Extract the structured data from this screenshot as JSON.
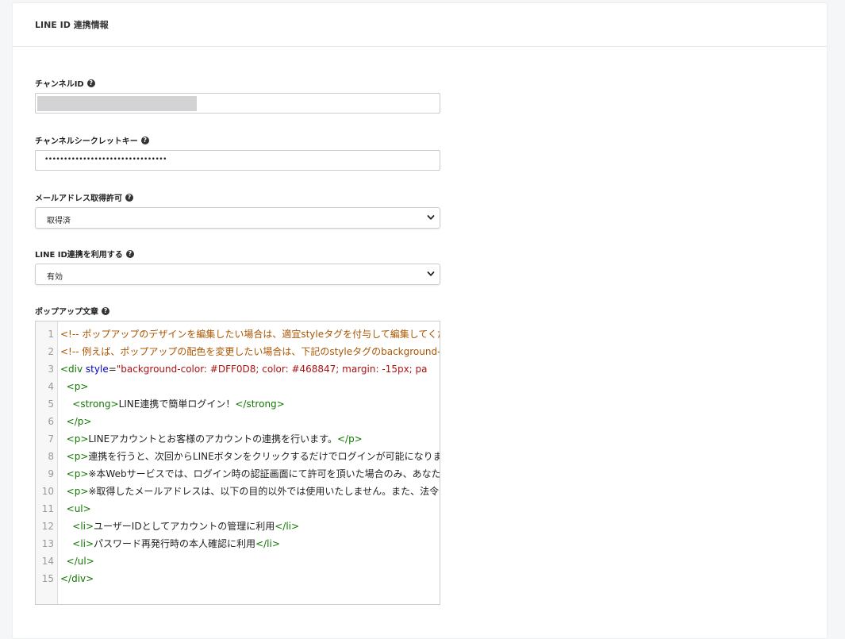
{
  "header": {
    "title": "LINE ID 連携情報"
  },
  "fields": {
    "channel_id": {
      "label": "チャンネルID"
    },
    "channel_secret": {
      "label": "チャンネルシークレットキー",
      "masked_value": "••••••••••••••••••••••••••••••••"
    },
    "email_permission": {
      "label": "メールアドレス取得許可",
      "selected": "取得済"
    },
    "line_id_enable": {
      "label": "LINE ID連携を利用する",
      "selected": "有効"
    },
    "popup_text": {
      "label": "ポップアップ文章"
    }
  },
  "code_lines": [
    {
      "n": "1",
      "parts": [
        {
          "t": "comment",
          "s": "<!-- ポップアップのデザインを編集したい場合は、適宜styleタグを付与して編集してくだ"
        }
      ]
    },
    {
      "n": "2",
      "parts": [
        {
          "t": "comment",
          "s": "<!-- 例えば、ポップアップの配色を変更したい場合は、下記のstyleタグのbackground-"
        }
      ]
    },
    {
      "n": "3",
      "parts": [
        {
          "t": "tag",
          "s": "<div "
        },
        {
          "t": "attr",
          "s": "style"
        },
        {
          "t": "plain",
          "s": "="
        },
        {
          "t": "str",
          "s": "\"background-color: #DFF0D8; color: #468847; margin: -15px; pa"
        }
      ]
    },
    {
      "n": "4",
      "parts": [
        {
          "t": "plain",
          "s": "  "
        },
        {
          "t": "tag",
          "s": "<p>"
        }
      ]
    },
    {
      "n": "5",
      "parts": [
        {
          "t": "plain",
          "s": "    "
        },
        {
          "t": "tag",
          "s": "<strong>"
        },
        {
          "t": "plain",
          "s": "LINE連携で簡単ログイン！"
        },
        {
          "t": "tag",
          "s": "</strong>"
        }
      ]
    },
    {
      "n": "6",
      "parts": [
        {
          "t": "plain",
          "s": "  "
        },
        {
          "t": "tag",
          "s": "</p>"
        }
      ]
    },
    {
      "n": "7",
      "parts": [
        {
          "t": "plain",
          "s": "  "
        },
        {
          "t": "tag",
          "s": "<p>"
        },
        {
          "t": "plain",
          "s": "LINEアカウントとお客様のアカウントの連携を行います。"
        },
        {
          "t": "tag",
          "s": "</p>"
        }
      ]
    },
    {
      "n": "8",
      "parts": [
        {
          "t": "plain",
          "s": "  "
        },
        {
          "t": "tag",
          "s": "<p>"
        },
        {
          "t": "plain",
          "s": "連携を行うと、次回からLINEボタンをクリックするだけでログインが可能になります。"
        }
      ]
    },
    {
      "n": "9",
      "parts": [
        {
          "t": "plain",
          "s": "  "
        },
        {
          "t": "tag",
          "s": "<p>"
        },
        {
          "t": "plain",
          "s": "※本Webサービスでは、ログイン時の認証画面にて許可を頂いた場合のみ、あなた"
        }
      ]
    },
    {
      "n": "10",
      "parts": [
        {
          "t": "plain",
          "s": "  "
        },
        {
          "t": "tag",
          "s": "<p>"
        },
        {
          "t": "plain",
          "s": "※取得したメールアドレスは、以下の目的以外では使用いたしません。また、法令に"
        }
      ]
    },
    {
      "n": "11",
      "parts": [
        {
          "t": "plain",
          "s": "  "
        },
        {
          "t": "tag",
          "s": "<ul>"
        }
      ]
    },
    {
      "n": "12",
      "parts": [
        {
          "t": "plain",
          "s": "    "
        },
        {
          "t": "tag",
          "s": "<li>"
        },
        {
          "t": "plain",
          "s": "ユーザーIDとしてアカウントの管理に利用"
        },
        {
          "t": "tag",
          "s": "</li>"
        }
      ]
    },
    {
      "n": "13",
      "parts": [
        {
          "t": "plain",
          "s": "    "
        },
        {
          "t": "tag",
          "s": "<li>"
        },
        {
          "t": "plain",
          "s": "パスワード再発行時の本人確認に利用"
        },
        {
          "t": "tag",
          "s": "</li>"
        }
      ]
    },
    {
      "n": "14",
      "parts": [
        {
          "t": "plain",
          "s": "  "
        },
        {
          "t": "tag",
          "s": "</ul>"
        }
      ]
    },
    {
      "n": "15",
      "parts": [
        {
          "t": "tag",
          "s": "</div>"
        }
      ]
    }
  ]
}
